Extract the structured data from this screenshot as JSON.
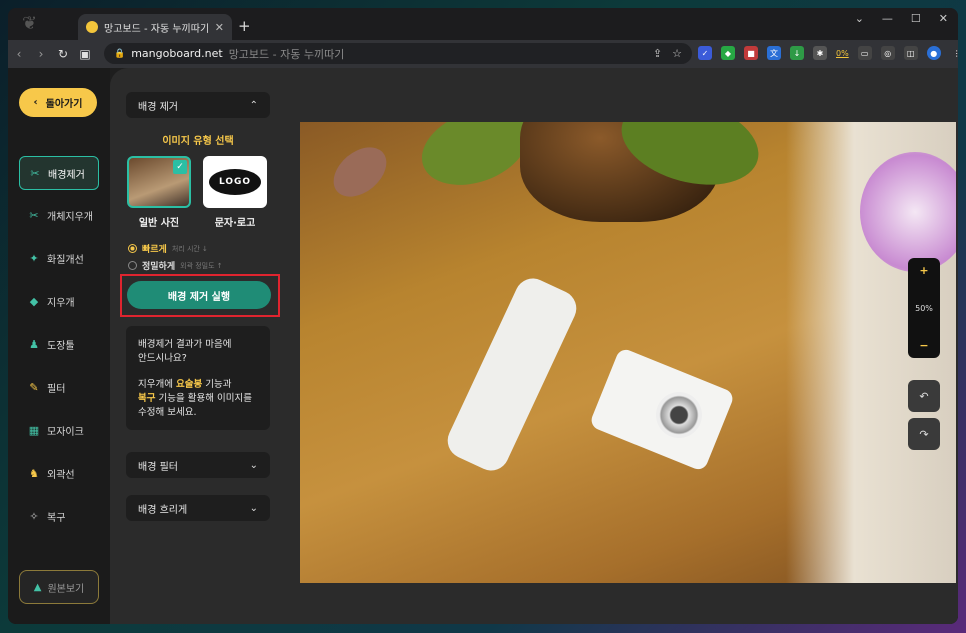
{
  "browser": {
    "tab_title": "망고보드 - 자동 누끼따기",
    "tab_close": "✕",
    "new_tab": "+",
    "url_host": "mangoboard.net",
    "url_rest": "망고보드 - 자동 누끼따기",
    "ext_zero": "0%",
    "window_controls": [
      "⌄",
      "—",
      "☐",
      "✕"
    ]
  },
  "sidebar": {
    "back_label": "돌아가기",
    "items": [
      {
        "label": "배경제거"
      },
      {
        "label": "개체지우개"
      },
      {
        "label": "화질개선"
      },
      {
        "label": "지우개"
      },
      {
        "label": "도장툴"
      },
      {
        "label": "필터"
      },
      {
        "label": "모자이크"
      },
      {
        "label": "외곽선"
      },
      {
        "label": "복구"
      }
    ],
    "original_label": "원본보기"
  },
  "panel": {
    "section_title": "배경 제거",
    "type_heading": "이미지 유형 선택",
    "type_photo_label": "일반 사진",
    "type_logo_label": "문자·로고",
    "logo_text": "LOGO",
    "speed": {
      "fast_label": "빠르게",
      "fast_hint": "처리 시간 ↓",
      "precise_label": "정밀하게",
      "precise_hint": "외곽 정밀도 ↑"
    },
    "run_label": "배경 제거 실행",
    "info_line1": "배경제거 결과가 마음에",
    "info_line2": "안드시나요?",
    "info_line3_pre": "지우개에 ",
    "info_line3_hl": "요술봉",
    "info_line3_post": " 기능과",
    "info_line4_hl": "복구",
    "info_line4_post": " 기능을 활용해 이미지를",
    "info_line5": "수정해 보세요.",
    "filter_title": "배경 필터",
    "blur_title": "배경 흐리게"
  },
  "canvas": {
    "zoom_level": "50%"
  },
  "colors": {
    "accent_yellow": "#f7c84a",
    "accent_teal": "#2bbfa4",
    "run_button": "#1f8c76",
    "highlight_red": "#e0242f"
  }
}
